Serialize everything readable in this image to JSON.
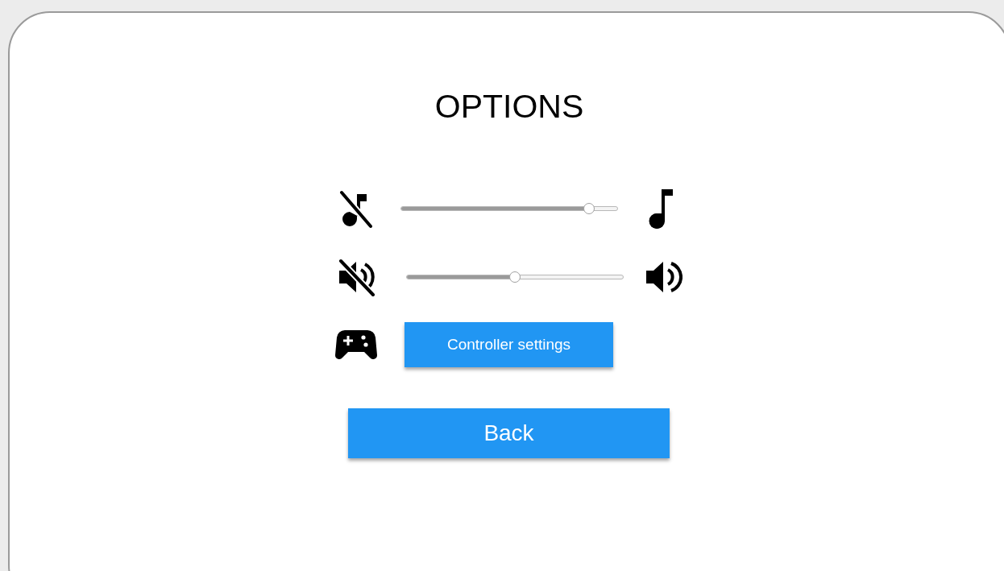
{
  "title": "OPTIONS",
  "settings": [
    {
      "kind": "music_slider",
      "level": 0.87
    },
    {
      "kind": "volume_slider",
      "level": 0.5
    },
    {
      "kind": "controller_button",
      "label": "Controller settings"
    }
  ],
  "back_button": "Back"
}
